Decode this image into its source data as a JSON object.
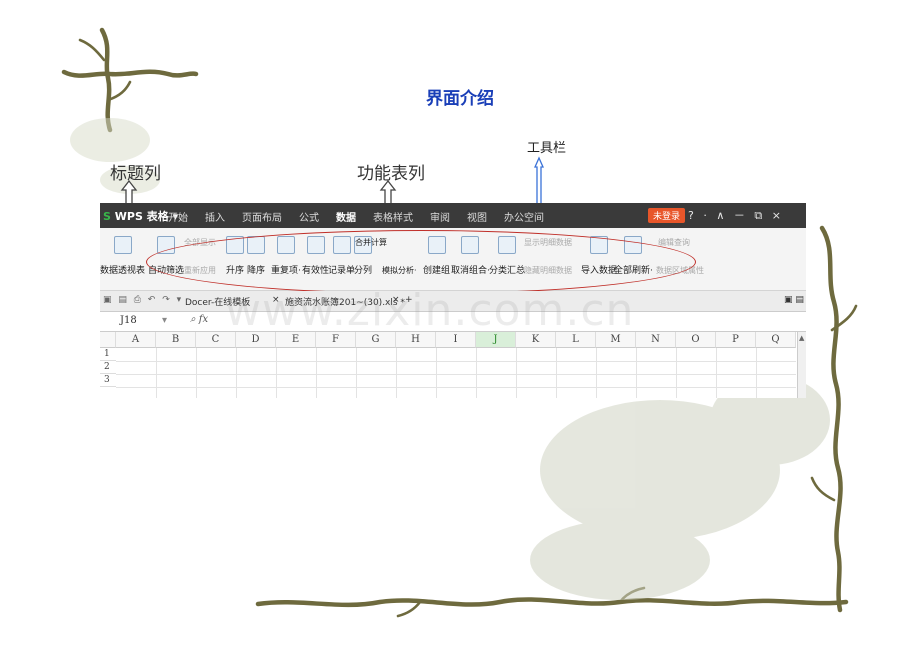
{
  "slide": {
    "title": "界面介绍",
    "annotations": {
      "title_bar": "标题列",
      "function_bar": "功能表列",
      "toolbar": "工具栏"
    },
    "watermark": "www.zixin.com.cn"
  },
  "window": {
    "app_logo": "WPS 表格",
    "menu_tabs": [
      "开始",
      "插入",
      "页面布局",
      "公式",
      "数据",
      "表格样式",
      "审阅",
      "视图",
      "办公空间"
    ],
    "active_tab": "数据",
    "login_label": "未登录",
    "window_controls": "? · ∧ － ⧉ ×"
  },
  "ribbon": {
    "buttons": [
      {
        "label": "数据透视表",
        "enabled": true
      },
      {
        "label": "自动筛选",
        "enabled": true
      },
      {
        "label": "升序",
        "enabled": true
      },
      {
        "label": "降序",
        "enabled": true
      },
      {
        "label": "重复项·",
        "enabled": true
      },
      {
        "label": "有效性",
        "enabled": true
      },
      {
        "label": "记录单",
        "enabled": true
      },
      {
        "label": "分列",
        "enabled": true
      },
      {
        "label": "创建组",
        "enabled": true
      },
      {
        "label": "取消组合·",
        "enabled": true
      },
      {
        "label": "分类汇总",
        "enabled": true
      },
      {
        "label": "导入数据",
        "enabled": true
      },
      {
        "label": "全部刷新·",
        "enabled": true
      }
    ],
    "small_items": [
      {
        "label": "全部显示",
        "enabled": false
      },
      {
        "label": "重新应用",
        "enabled": false
      },
      {
        "label": "合并计算",
        "enabled": true
      },
      {
        "label": "模拟分析·",
        "enabled": true
      },
      {
        "label": "显示明细数据",
        "enabled": false
      },
      {
        "label": "隐藏明细数据",
        "enabled": false
      },
      {
        "label": "编辑查询",
        "enabled": false
      },
      {
        "label": "数据区域属性",
        "enabled": false
      }
    ]
  },
  "document_tabs": [
    {
      "label": "Docer-在线模板",
      "closable": true
    },
    {
      "label": "施资流水账簿201~(30).xls *",
      "closable": true
    }
  ],
  "formula_bar": {
    "cell_ref": "J18",
    "fx_label": "fx",
    "value": ""
  },
  "sheet": {
    "columns": [
      "A",
      "B",
      "C",
      "D",
      "E",
      "F",
      "G",
      "H",
      "I",
      "J",
      "K",
      "L",
      "M",
      "N",
      "O",
      "P",
      "Q"
    ],
    "selected_column": "J",
    "rows": [
      "1",
      "2",
      "3"
    ]
  },
  "colors": {
    "ribbon_highlight": "#c0302a",
    "title_text": "#1a3fb8",
    "login_badge": "#e8562a",
    "titlebar": "#3a3a3a"
  }
}
